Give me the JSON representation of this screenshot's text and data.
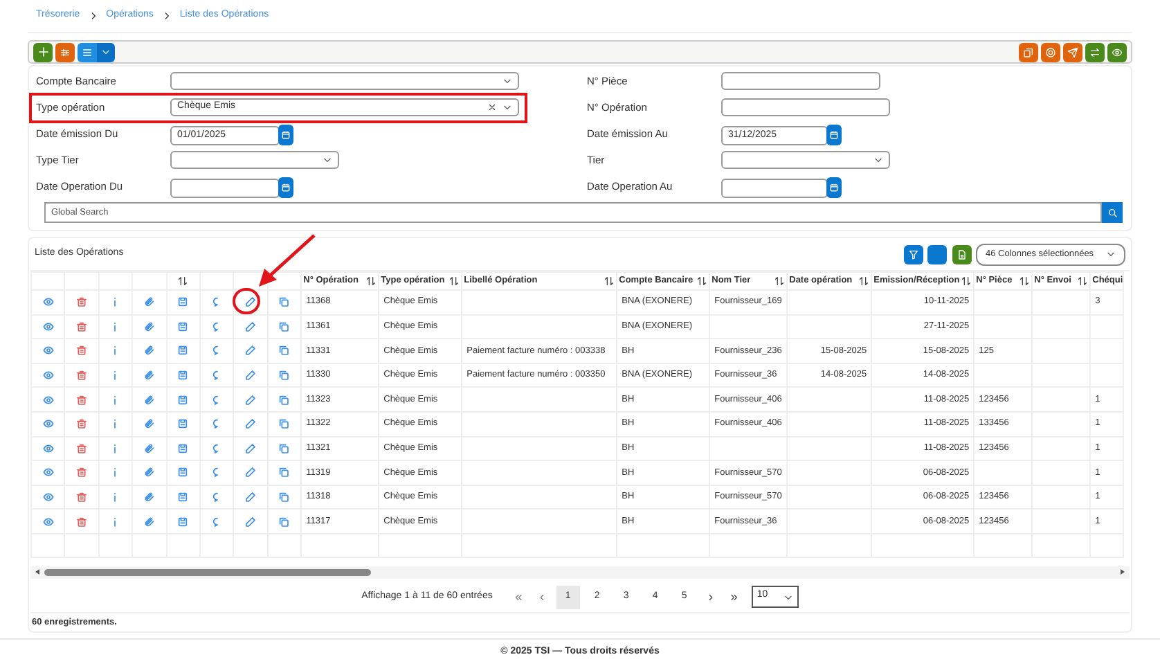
{
  "breadcrumb": [
    "Trésorerie",
    "Opérations",
    "Liste des Opérations"
  ],
  "filters": [
    {
      "label": "Compte Bancaire",
      "kind": "select"
    },
    {
      "label": "N° Pièce",
      "kind": "text"
    },
    {
      "label": "Type opération",
      "kind": "select",
      "value": "Chèque Emis",
      "clearable": true,
      "highlighted": true
    },
    {
      "label": "N° Opération",
      "kind": "text"
    },
    {
      "label": "Date émission Du",
      "kind": "date",
      "value": "01/01/2025"
    },
    {
      "label": "Date émission Au",
      "kind": "date",
      "value": "31/12/2025"
    },
    {
      "label": "Type Tier",
      "kind": "select"
    },
    {
      "label": "Tier",
      "kind": "select"
    },
    {
      "label": "Date Operation Du",
      "kind": "date"
    },
    {
      "label": "Date Operation Au",
      "kind": "date"
    }
  ],
  "global_search": {
    "placeholder": "Global Search"
  },
  "list": {
    "title": "Liste des Opérations",
    "columns_select": "46 Colonnes sélectionnées",
    "action_columns": [
      {
        "kind": "view",
        "sortable": false
      },
      {
        "kind": "delete",
        "sortable": false
      },
      {
        "kind": "info",
        "sortable": false
      },
      {
        "kind": "attach",
        "sortable": false
      },
      {
        "kind": "save",
        "sortable": true
      },
      {
        "kind": "comment",
        "sortable": false
      },
      {
        "kind": "edit",
        "sortable": false
      },
      {
        "kind": "copy",
        "sortable": false
      }
    ],
    "columns": [
      {
        "label": "N° Opération",
        "sortable": true
      },
      {
        "label": "Type opération",
        "sortable": true
      },
      {
        "label": "Libellé Opération",
        "sortable": true
      },
      {
        "label": "Compte Bancaire",
        "sortable": true
      },
      {
        "label": "Nom Tier",
        "sortable": true
      },
      {
        "label": "Date opération",
        "sortable": true
      },
      {
        "label": "Emission/Réception",
        "sortable": true
      },
      {
        "label": "N° Pièce",
        "sortable": true
      },
      {
        "label": "N° Envoi",
        "sortable": true
      },
      {
        "label": "Chéqui"
      }
    ],
    "rows": [
      [
        "11368",
        "Chèque Emis",
        "",
        "BNA (EXONERE)",
        "Fournisseur_169",
        "",
        "10-11-2025",
        "",
        "",
        "3"
      ],
      [
        "11361",
        "Chèque Emis",
        "",
        "BNA (EXONERE)",
        "",
        "",
        "27-11-2025",
        "",
        "",
        ""
      ],
      [
        "11331",
        "Chèque Emis",
        "Paiement facture numéro : 003338",
        "BH",
        "Fournisseur_236",
        "15-08-2025",
        "15-08-2025",
        "125",
        "",
        ""
      ],
      [
        "11330",
        "Chèque Emis",
        "Paiement facture numéro : 003350",
        "BNA (EXONERE)",
        "Fournisseur_36",
        "14-08-2025",
        "14-08-2025",
        "",
        "",
        ""
      ],
      [
        "11323",
        "Chèque Emis",
        "",
        "BH",
        "Fournisseur_406",
        "",
        "11-08-2025",
        "123456",
        "",
        "1"
      ],
      [
        "11322",
        "Chèque Emis",
        "",
        "BH",
        "Fournisseur_406",
        "",
        "11-08-2025",
        "133456",
        "",
        "1"
      ],
      [
        "11321",
        "Chèque Emis",
        "",
        "BH",
        "",
        "",
        "11-08-2025",
        "123456",
        "",
        "1"
      ],
      [
        "11319",
        "Chèque Emis",
        "",
        "BH",
        "Fournisseur_570",
        "",
        "06-08-2025",
        "",
        "",
        "1"
      ],
      [
        "11318",
        "Chèque Emis",
        "",
        "BH",
        "Fournisseur_570",
        "",
        "06-08-2025",
        "123456",
        "",
        "1"
      ],
      [
        "11317",
        "Chèque Emis",
        "",
        "BH",
        "Fournisseur_36",
        "",
        "06-08-2025",
        "123456",
        "",
        "1"
      ]
    ],
    "pagination": {
      "summary": "Affichage 1 à 11 de 60 entrées",
      "pages": [
        {
          "label": "1",
          "selected": true
        },
        {
          "label": "2",
          "selected": false
        },
        {
          "label": "3",
          "selected": false
        },
        {
          "label": "4",
          "selected": false
        },
        {
          "label": "5",
          "selected": false
        }
      ],
      "page_size": "10"
    },
    "record_count": "60 enregistrements."
  },
  "footer": "© 2025 TSI — Tous droits réservés"
}
